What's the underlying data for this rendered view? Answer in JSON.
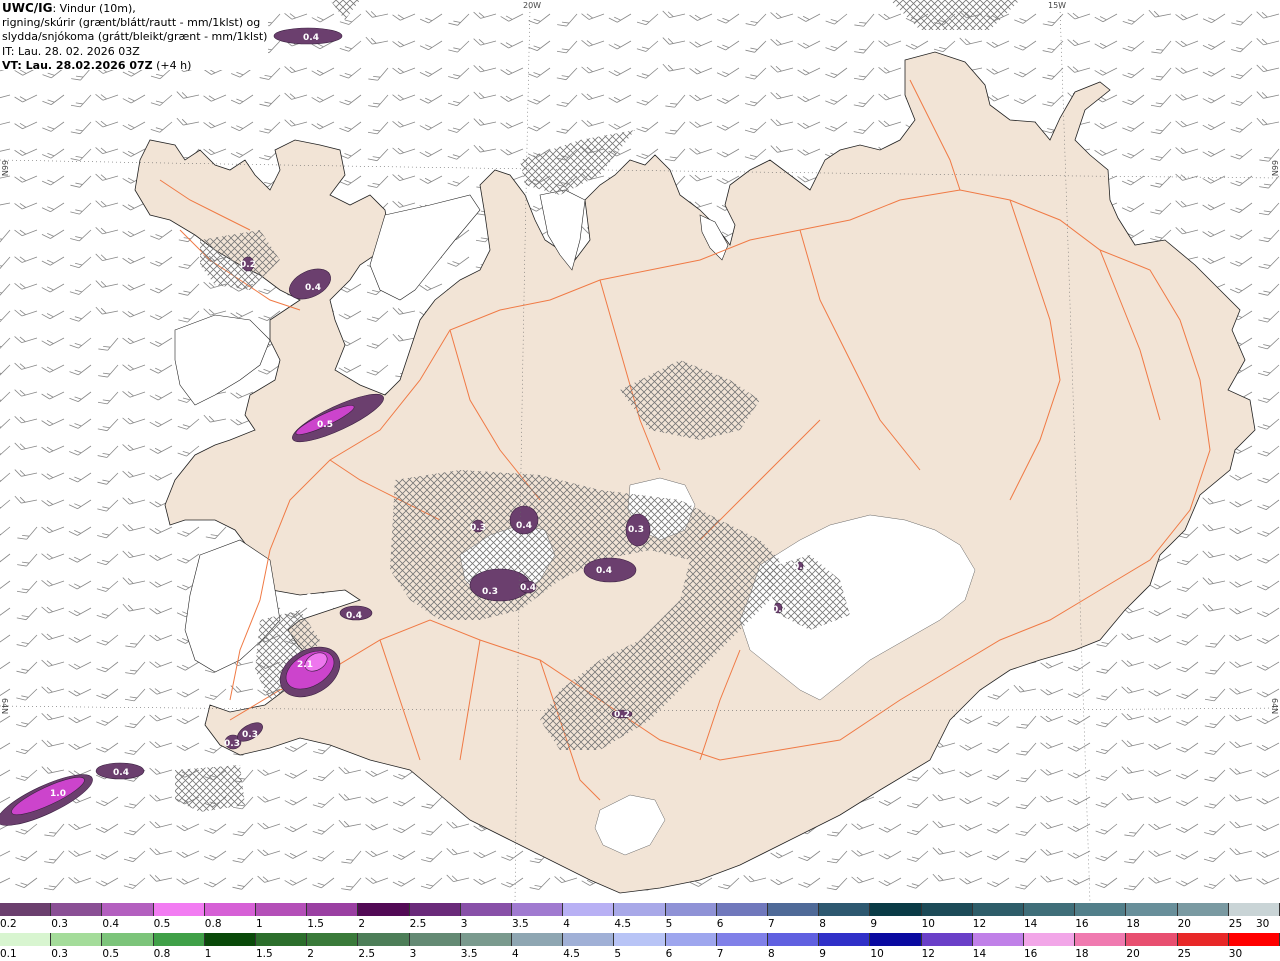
{
  "header": {
    "title": "UWC/IG",
    "title_suffix": ": Vindur (10m),",
    "line2": "rigning/skúrir (grænt/blátt/rautt - mm/1klst) og",
    "line3": "slydda/snjókoma (grátt/bleikt/grænt - mm/1klst)",
    "line4": "IT: Lau. 28. 02. 2026 03Z",
    "vt_bold": "VT: Lau. 28.02.2026 07Z",
    "vt_suffix": " (+4 h)"
  },
  "graticule": {
    "lon_labels": [
      "20W",
      "15W"
    ],
    "lat_labels": [
      "66N",
      "64N"
    ]
  },
  "colors": {
    "land": "#f2e4d6",
    "road": "#f07a45",
    "precip_dark": "#6a3f6e",
    "precip_magenta": "#cc44cc",
    "precip_pink": "#ee77ee",
    "hatch": "#777777",
    "wind_barb": "#888888"
  },
  "precip_labels": [
    "0.4",
    "0.4",
    "0.2",
    "0.5",
    "0.4",
    "0.3",
    "0.3",
    "0.4",
    "0.3",
    "0.4",
    "0.4",
    "0.4",
    "2.1",
    "0.3",
    "0.3",
    "0.4",
    "1.0",
    "0.2",
    "0.2",
    "0.4"
  ],
  "snow_scale": {
    "labels": [
      "0.2",
      "0.3",
      "0.4",
      "0.5",
      "0.8",
      "1",
      "1.5",
      "2",
      "2.5",
      "3",
      "3.5",
      "4",
      "4.5",
      "5",
      "6",
      "7",
      "8",
      "9",
      "10",
      "12",
      "14",
      "16",
      "18",
      "20",
      "25",
      "30"
    ],
    "colors": [
      "#6b3f6e",
      "#8a4f95",
      "#b35fbf",
      "#f27cf2",
      "#d660d6",
      "#b44fb8",
      "#9a3fa2",
      "#520a55",
      "#6a2a7a",
      "#8850a8",
      "#a07ad0",
      "#b8b0f4",
      "#a8a8e8",
      "#8f92d6",
      "#7078bc",
      "#4f6a98",
      "#2d5870",
      "#0a3b46",
      "#1d4b58",
      "#2e5d69",
      "#3f6e79",
      "#527f8a",
      "#688f9a",
      "#7a9aa2",
      "#c9d4d6"
    ]
  },
  "rain_scale": {
    "labels": [
      "0.1",
      "0.3",
      "0.5",
      "0.8",
      "1",
      "1.5",
      "2",
      "2.5",
      "3",
      "3.5",
      "4",
      "4.5",
      "5",
      "6",
      "7",
      "8",
      "9",
      "10",
      "12",
      "14",
      "16",
      "18",
      "20",
      "25",
      "30"
    ],
    "colors": [
      "#d8f5d0",
      "#a4dc9a",
      "#7cc47a",
      "#40a048",
      "#0a4a0a",
      "#2c6e2c",
      "#3a7a3a",
      "#4d7e58",
      "#648a74",
      "#7a9a8e",
      "#8ea6b2",
      "#a0b0d6",
      "#b8c4f6",
      "#9ea6ee",
      "#8080e8",
      "#6060e0",
      "#3030c8",
      "#0a0aa0",
      "#6a3fc8",
      "#c080e8",
      "#f2a6e8",
      "#f07ab0",
      "#e84f70",
      "#e82828",
      "#ff0000"
    ]
  }
}
